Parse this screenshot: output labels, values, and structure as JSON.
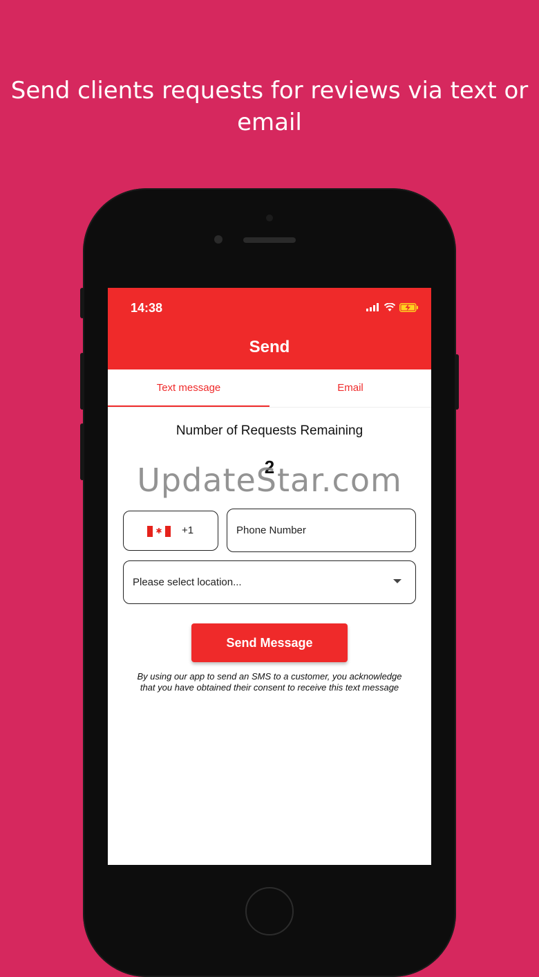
{
  "headline": {
    "line1": "Send clients requests for reviews via text or",
    "line2": "email"
  },
  "status_bar": {
    "time": "14:38"
  },
  "app_bar": {
    "title": "Send"
  },
  "tabs": [
    {
      "label": "Text message",
      "active": true
    },
    {
      "label": "Email",
      "active": false
    }
  ],
  "requests": {
    "label": "Number of Requests Remaining",
    "count": "2"
  },
  "phone_form": {
    "country_flag": "canada-flag-icon",
    "dial_code": "+1",
    "phone_placeholder": "Phone Number",
    "location_placeholder": "Please select location..."
  },
  "send_button": {
    "label": "Send Message"
  },
  "disclaimer": {
    "line1": "By using our app to send an SMS to a customer, you acknowledge",
    "line2": "that you have obtained their consent to receive this text message"
  },
  "watermark": "UpdateStar.com",
  "colors": {
    "background": "#d6285e",
    "accent": "#ef2a2a",
    "phone_body": "#0d0d0d"
  }
}
